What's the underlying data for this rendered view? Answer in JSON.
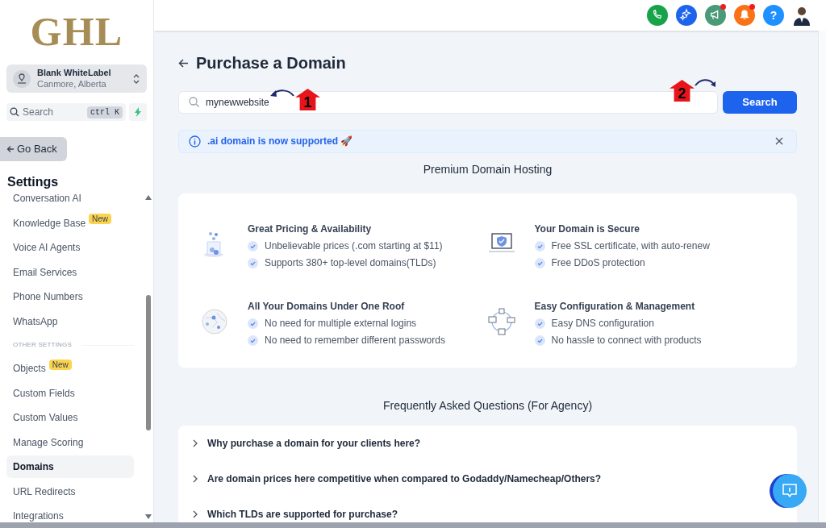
{
  "sidebar": {
    "logo": "GHL",
    "account": {
      "name": "Blank WhiteLabel",
      "location": "Canmore, Alberta"
    },
    "search": {
      "placeholder": "Search",
      "shortcut": "ctrl K"
    },
    "back_button": "Go Back",
    "heading": "Settings",
    "items": [
      {
        "kind": "item",
        "label": "Conversation AI",
        "selected": false
      },
      {
        "kind": "item",
        "label": "Knowledge Base",
        "badge": "New",
        "selected": false
      },
      {
        "kind": "item",
        "label": "Voice AI Agents",
        "selected": false
      },
      {
        "kind": "item",
        "label": "Email Services",
        "selected": false
      },
      {
        "kind": "item",
        "label": "Phone Numbers",
        "selected": false
      },
      {
        "kind": "item",
        "label": "WhatsApp",
        "selected": false
      },
      {
        "kind": "heading",
        "label": "OTHER SETTINGS"
      },
      {
        "kind": "item",
        "label": "Objects",
        "badge": "New",
        "selected": false
      },
      {
        "kind": "item",
        "label": "Custom Fields",
        "selected": false
      },
      {
        "kind": "item",
        "label": "Custom Values",
        "selected": false
      },
      {
        "kind": "item",
        "label": "Manage Scoring",
        "selected": false
      },
      {
        "kind": "item",
        "label": "Domains",
        "selected": true
      },
      {
        "kind": "item",
        "label": "URL Redirects",
        "selected": false
      },
      {
        "kind": "item",
        "label": "Integrations",
        "selected": false
      }
    ]
  },
  "topbar": {
    "actions": [
      {
        "kind": "phone",
        "color": "#16a34a",
        "notification": false
      },
      {
        "kind": "sparkle",
        "color": "#1d63ed",
        "notification": false
      },
      {
        "kind": "megaphone",
        "color": "#4a9a78",
        "notification": true
      },
      {
        "kind": "bell",
        "color": "#f97316",
        "notification": true
      },
      {
        "kind": "help",
        "label": "?",
        "color": "#1e90ff",
        "notification": false
      }
    ]
  },
  "page": {
    "title": "Purchase a Domain",
    "search": {
      "value": "mynewwebsite",
      "button": "Search"
    },
    "banner": {
      "text": ".ai domain is now supported 🚀"
    },
    "hosting_title": "Premium Domain Hosting",
    "features": [
      {
        "kind": "coins",
        "title": "Great Pricing & Availability",
        "points": [
          "Unbelievable prices (.com starting at $11)",
          "Supports 380+ top-level domains(TLDs)"
        ]
      },
      {
        "kind": "laptop",
        "title": "Your Domain is Secure",
        "points": [
          "Free SSL certificate, with auto-renew",
          "Free DDoS protection"
        ]
      },
      {
        "kind": "globe",
        "title": "All Your Domains Under One Roof",
        "points": [
          "No need for multiple external logins",
          "No need to remember different passwords"
        ]
      },
      {
        "kind": "network",
        "title": "Easy Configuration & Management",
        "points": [
          "Easy DNS configuration",
          "No hassle to connect with products"
        ]
      }
    ],
    "faq_title": "Frequently Asked Questions (For Agency)",
    "faqs": [
      {
        "question": "Why purchase a domain for your clients here?",
        "expanded": false
      },
      {
        "question": "Are domain prices here competitive when compared to Godaddy/Namecheap/Others?",
        "expanded": false
      },
      {
        "question": "Which TLDs are supported for purchase?",
        "expanded": false
      }
    ]
  },
  "annotations": [
    {
      "label": "1"
    },
    {
      "label": "2"
    }
  ]
}
